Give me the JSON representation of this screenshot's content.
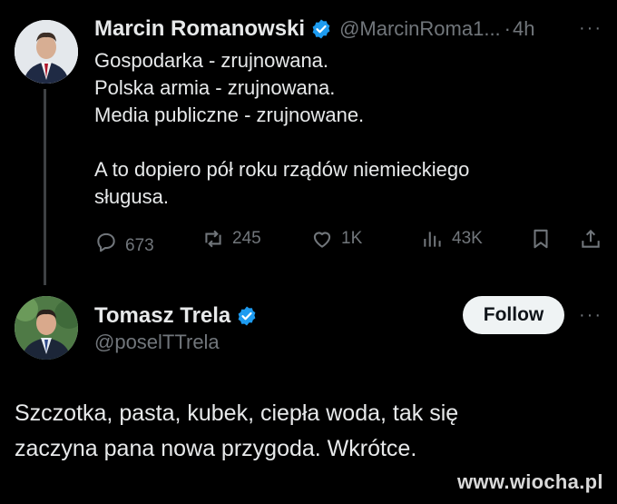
{
  "tweet1": {
    "author_name": "Marcin Romanowski",
    "handle": "@MarcinRoma1...",
    "separator": "·",
    "time": "4h",
    "more": "···",
    "lines": "Gospodarka - zrujnowana.\nPolska armia - zrujnowana.\nMedia publiczne - zrujnowane.\n\nA to dopiero pół roku rządów niemieckiego\nsługusa.",
    "actions": {
      "replies": "673",
      "reposts": "245",
      "likes": "1K",
      "views": "43K"
    }
  },
  "tweet2": {
    "author_name": "Tomasz Trela",
    "handle": "@poselTTrela",
    "follow_label": "Follow",
    "more": "···",
    "text": "Szczotka, pasta, kubek, ciepła woda, tak się\nzaczyna pana nowa przygoda. Wkrótce."
  },
  "watermark": "www.wiocha.pl",
  "colors": {
    "background": "#000000",
    "text": "#e7e9ea",
    "muted": "#71767b",
    "verified": "#1d9bf0",
    "follow_bg": "#eff3f4"
  },
  "icons": [
    "verified-badge-icon",
    "reply-icon",
    "repost-icon",
    "like-icon",
    "views-icon",
    "bookmark-icon",
    "share-icon",
    "more-icon"
  ]
}
